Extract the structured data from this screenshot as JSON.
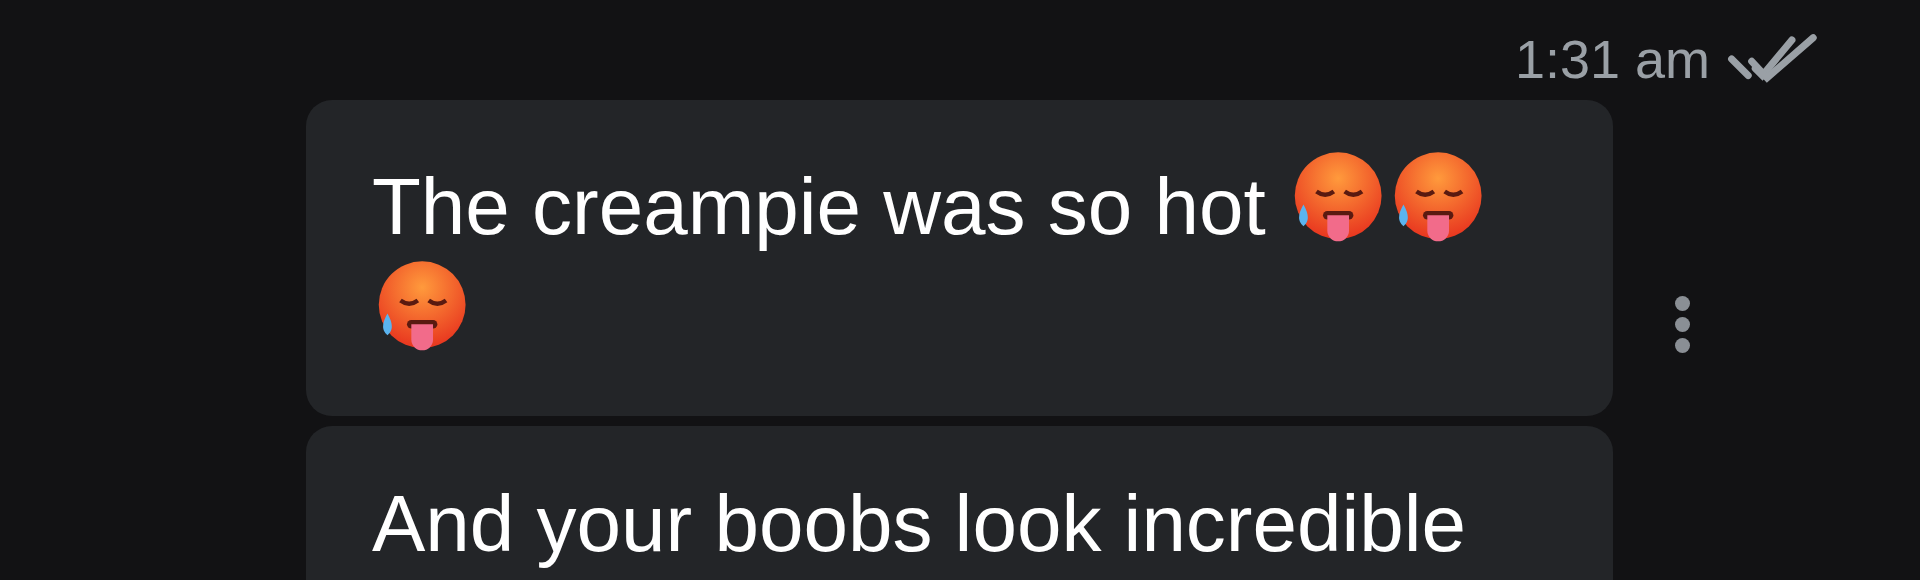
{
  "status": {
    "time": "1:31 am",
    "read": true
  },
  "messages": [
    {
      "parts": [
        {
          "kind": "text",
          "text": "The creampie was so hot "
        },
        {
          "kind": "emoji"
        },
        {
          "kind": "emoji"
        },
        {
          "kind": "emoji"
        }
      ],
      "menu": true
    },
    {
      "parts": [
        {
          "kind": "text",
          "text": "And your boobs look incredible"
        }
      ],
      "menu": false
    }
  ]
}
